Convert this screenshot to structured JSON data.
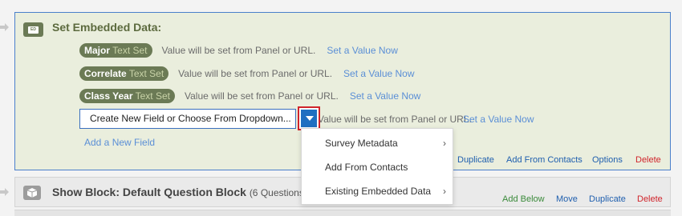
{
  "embedded_data": {
    "title": "Set Embedded Data:",
    "icon_text": "ED",
    "fields": [
      {
        "name": "Major",
        "type": "Text Set",
        "note": "Value will be set from Panel or URL.",
        "link": "Set a Value Now"
      },
      {
        "name": "Correlate",
        "type": "Text Set",
        "note": "Value will be set from Panel or URL.",
        "link": "Set a Value Now"
      },
      {
        "name": "Class Year",
        "type": "Text Set",
        "note": "Value will be set from Panel or URL.",
        "link": "Set a Value Now"
      }
    ],
    "new_field": {
      "value": "Create New Field or Choose From Dropdown...",
      "note": "Value will be set from Panel or URL.",
      "link": "Set a Value Now"
    },
    "add_field_link": "Add a New Field",
    "actions": {
      "duplicate": "Duplicate",
      "add_from_contacts": "Add From Contacts",
      "options": "Options",
      "delete": "Delete"
    }
  },
  "dropdown_menu": {
    "items": [
      {
        "label": "Survey Metadata",
        "chevron": "›"
      },
      {
        "label": "Add From Contacts",
        "chevron": ""
      },
      {
        "label": "Existing Embedded Data",
        "chevron": "›"
      }
    ]
  },
  "show_block": {
    "title": "Show Block: Default Question Block",
    "count": "(6 Questions)",
    "actions": {
      "add_below": "Add Below",
      "move": "Move",
      "duplicate": "Duplicate",
      "delete": "Delete"
    }
  },
  "colors": {
    "accent_blue": "#1f6fc1",
    "olive": "#6b7a55",
    "delete_red": "#d0242b",
    "link_blue": "#5b8fd6"
  }
}
